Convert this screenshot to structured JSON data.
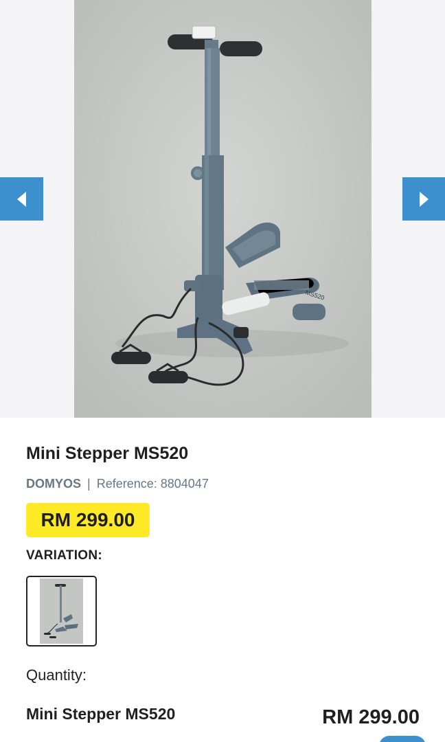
{
  "gallery": {
    "prev_icon": "chevron-left-icon",
    "next_icon": "chevron-right-icon",
    "image_label": "MS520"
  },
  "product": {
    "title": "Mini Stepper MS520",
    "brand": "DOMYOS",
    "separator": "|",
    "reference": "Reference: 8804047",
    "price": "RM 299.00"
  },
  "variation": {
    "label": "VARIATION:"
  },
  "quantity": {
    "label": "Quantity:"
  },
  "summary": {
    "name": "Mini Stepper MS520",
    "price": "RM 299.00"
  },
  "colors": {
    "accent": "#3c90cd",
    "price_badge": "#ffea28",
    "meta_text": "#687787"
  }
}
